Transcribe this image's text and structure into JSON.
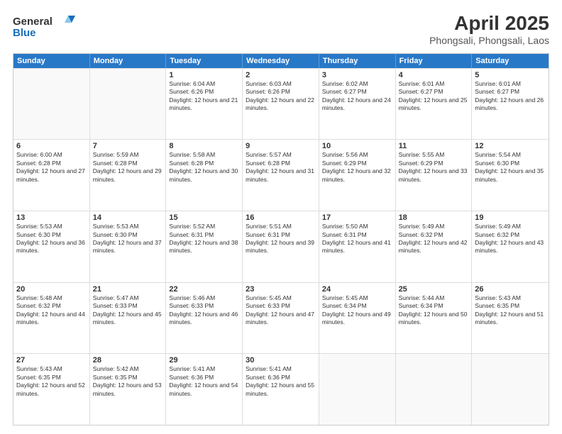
{
  "logo": {
    "line1": "General",
    "line2": "Blue"
  },
  "title": "April 2025",
  "subtitle": "Phongsali, Phongsali, Laos",
  "days": [
    "Sunday",
    "Monday",
    "Tuesday",
    "Wednesday",
    "Thursday",
    "Friday",
    "Saturday"
  ],
  "weeks": [
    [
      {
        "day": "",
        "info": ""
      },
      {
        "day": "",
        "info": ""
      },
      {
        "day": "1",
        "info": "Sunrise: 6:04 AM\nSunset: 6:26 PM\nDaylight: 12 hours and 21 minutes."
      },
      {
        "day": "2",
        "info": "Sunrise: 6:03 AM\nSunset: 6:26 PM\nDaylight: 12 hours and 22 minutes."
      },
      {
        "day": "3",
        "info": "Sunrise: 6:02 AM\nSunset: 6:27 PM\nDaylight: 12 hours and 24 minutes."
      },
      {
        "day": "4",
        "info": "Sunrise: 6:01 AM\nSunset: 6:27 PM\nDaylight: 12 hours and 25 minutes."
      },
      {
        "day": "5",
        "info": "Sunrise: 6:01 AM\nSunset: 6:27 PM\nDaylight: 12 hours and 26 minutes."
      }
    ],
    [
      {
        "day": "6",
        "info": "Sunrise: 6:00 AM\nSunset: 6:28 PM\nDaylight: 12 hours and 27 minutes."
      },
      {
        "day": "7",
        "info": "Sunrise: 5:59 AM\nSunset: 6:28 PM\nDaylight: 12 hours and 29 minutes."
      },
      {
        "day": "8",
        "info": "Sunrise: 5:58 AM\nSunset: 6:28 PM\nDaylight: 12 hours and 30 minutes."
      },
      {
        "day": "9",
        "info": "Sunrise: 5:57 AM\nSunset: 6:28 PM\nDaylight: 12 hours and 31 minutes."
      },
      {
        "day": "10",
        "info": "Sunrise: 5:56 AM\nSunset: 6:29 PM\nDaylight: 12 hours and 32 minutes."
      },
      {
        "day": "11",
        "info": "Sunrise: 5:55 AM\nSunset: 6:29 PM\nDaylight: 12 hours and 33 minutes."
      },
      {
        "day": "12",
        "info": "Sunrise: 5:54 AM\nSunset: 6:30 PM\nDaylight: 12 hours and 35 minutes."
      }
    ],
    [
      {
        "day": "13",
        "info": "Sunrise: 5:53 AM\nSunset: 6:30 PM\nDaylight: 12 hours and 36 minutes."
      },
      {
        "day": "14",
        "info": "Sunrise: 5:53 AM\nSunset: 6:30 PM\nDaylight: 12 hours and 37 minutes."
      },
      {
        "day": "15",
        "info": "Sunrise: 5:52 AM\nSunset: 6:31 PM\nDaylight: 12 hours and 38 minutes."
      },
      {
        "day": "16",
        "info": "Sunrise: 5:51 AM\nSunset: 6:31 PM\nDaylight: 12 hours and 39 minutes."
      },
      {
        "day": "17",
        "info": "Sunrise: 5:50 AM\nSunset: 6:31 PM\nDaylight: 12 hours and 41 minutes."
      },
      {
        "day": "18",
        "info": "Sunrise: 5:49 AM\nSunset: 6:32 PM\nDaylight: 12 hours and 42 minutes."
      },
      {
        "day": "19",
        "info": "Sunrise: 5:49 AM\nSunset: 6:32 PM\nDaylight: 12 hours and 43 minutes."
      }
    ],
    [
      {
        "day": "20",
        "info": "Sunrise: 5:48 AM\nSunset: 6:32 PM\nDaylight: 12 hours and 44 minutes."
      },
      {
        "day": "21",
        "info": "Sunrise: 5:47 AM\nSunset: 6:33 PM\nDaylight: 12 hours and 45 minutes."
      },
      {
        "day": "22",
        "info": "Sunrise: 5:46 AM\nSunset: 6:33 PM\nDaylight: 12 hours and 46 minutes."
      },
      {
        "day": "23",
        "info": "Sunrise: 5:45 AM\nSunset: 6:33 PM\nDaylight: 12 hours and 47 minutes."
      },
      {
        "day": "24",
        "info": "Sunrise: 5:45 AM\nSunset: 6:34 PM\nDaylight: 12 hours and 49 minutes."
      },
      {
        "day": "25",
        "info": "Sunrise: 5:44 AM\nSunset: 6:34 PM\nDaylight: 12 hours and 50 minutes."
      },
      {
        "day": "26",
        "info": "Sunrise: 5:43 AM\nSunset: 6:35 PM\nDaylight: 12 hours and 51 minutes."
      }
    ],
    [
      {
        "day": "27",
        "info": "Sunrise: 5:43 AM\nSunset: 6:35 PM\nDaylight: 12 hours and 52 minutes."
      },
      {
        "day": "28",
        "info": "Sunrise: 5:42 AM\nSunset: 6:35 PM\nDaylight: 12 hours and 53 minutes."
      },
      {
        "day": "29",
        "info": "Sunrise: 5:41 AM\nSunset: 6:36 PM\nDaylight: 12 hours and 54 minutes."
      },
      {
        "day": "30",
        "info": "Sunrise: 5:41 AM\nSunset: 6:36 PM\nDaylight: 12 hours and 55 minutes."
      },
      {
        "day": "",
        "info": ""
      },
      {
        "day": "",
        "info": ""
      },
      {
        "day": "",
        "info": ""
      }
    ]
  ]
}
